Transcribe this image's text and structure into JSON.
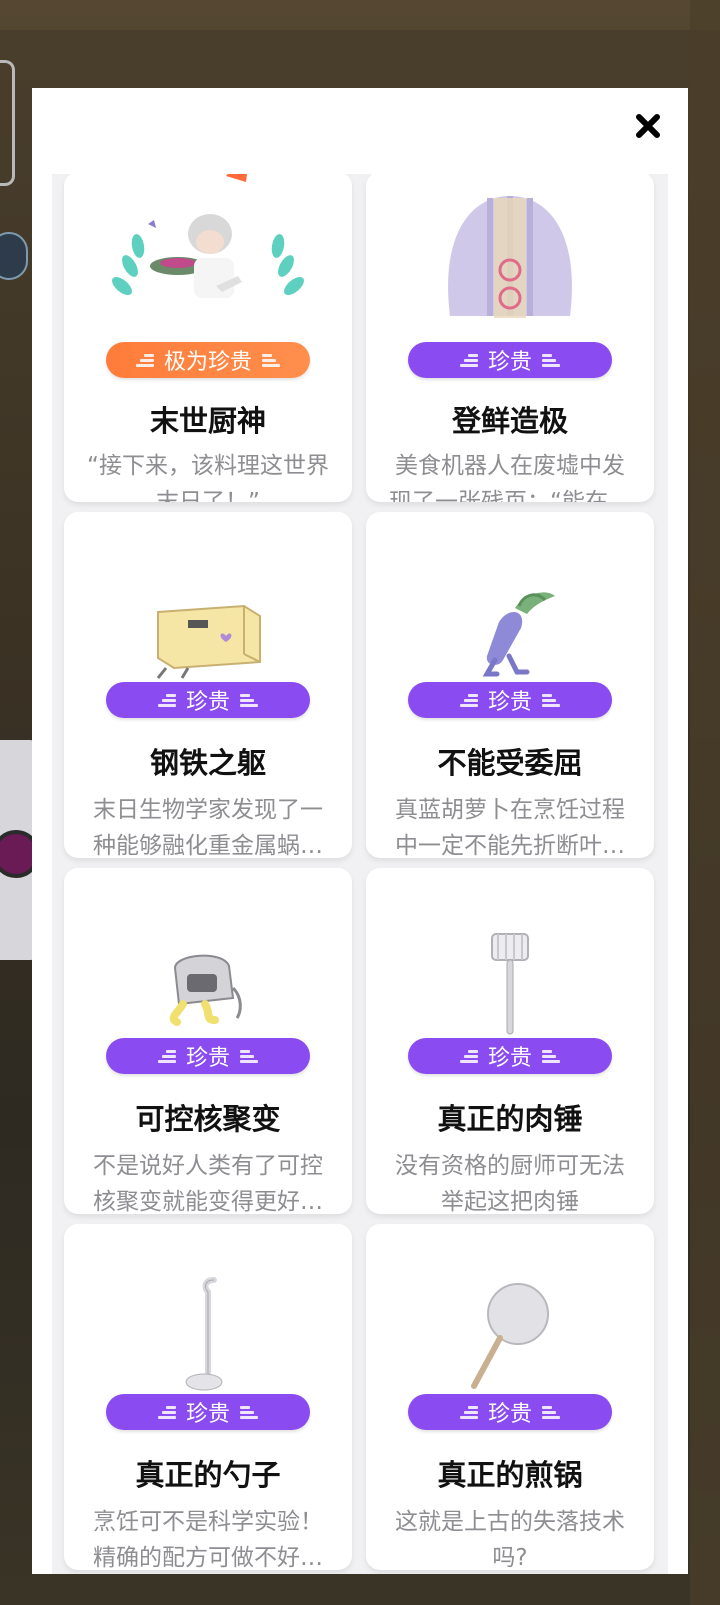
{
  "modal": {
    "close_icon": "close-icon"
  },
  "cards": [
    {
      "rarity": "极为珍贵",
      "title": "末世厨神",
      "desc": "“接下来，该料理这世界末日了！”",
      "art": "chef-character-art",
      "accent": "#ff7c3a"
    },
    {
      "rarity": "珍贵",
      "title": "登鲜造极",
      "desc": "美食机器人在废墟中发现了一张残页：“能在…",
      "art": "scallop-shell-art",
      "accent": "#8a4cf0"
    },
    {
      "rarity": "珍贵",
      "title": "钢铁之躯",
      "desc": "末日生物学家发现了一种能够融化重金属蜗…",
      "art": "box-creature-art",
      "accent": "#8a4cf0"
    },
    {
      "rarity": "珍贵",
      "title": "不能受委屈",
      "desc": "真蓝胡萝卜在烹饪过程中一定不能先折断叶…",
      "art": "blue-carrot-art",
      "accent": "#8a4cf0"
    },
    {
      "rarity": "珍贵",
      "title": "可控核聚变",
      "desc": "不是说好人类有了可控核聚变就能变得更好…",
      "art": "reactor-creature-art",
      "accent": "#8a4cf0"
    },
    {
      "rarity": "珍贵",
      "title": "真正的肉锤",
      "desc": "没有资格的厨师可无法举起这把肉锤",
      "art": "meat-hammer-art",
      "accent": "#8a4cf0"
    },
    {
      "rarity": "珍贵",
      "title": "真正的勺子",
      "desc": "烹饪可不是科学实验！精确的配方可做不好…",
      "art": "ladle-art",
      "accent": "#8a4cf0"
    },
    {
      "rarity": "珍贵",
      "title": "真正的煎锅",
      "desc": "这就是上古的失落技术吗?",
      "art": "frying-pan-art",
      "accent": "#8a4cf0"
    }
  ]
}
